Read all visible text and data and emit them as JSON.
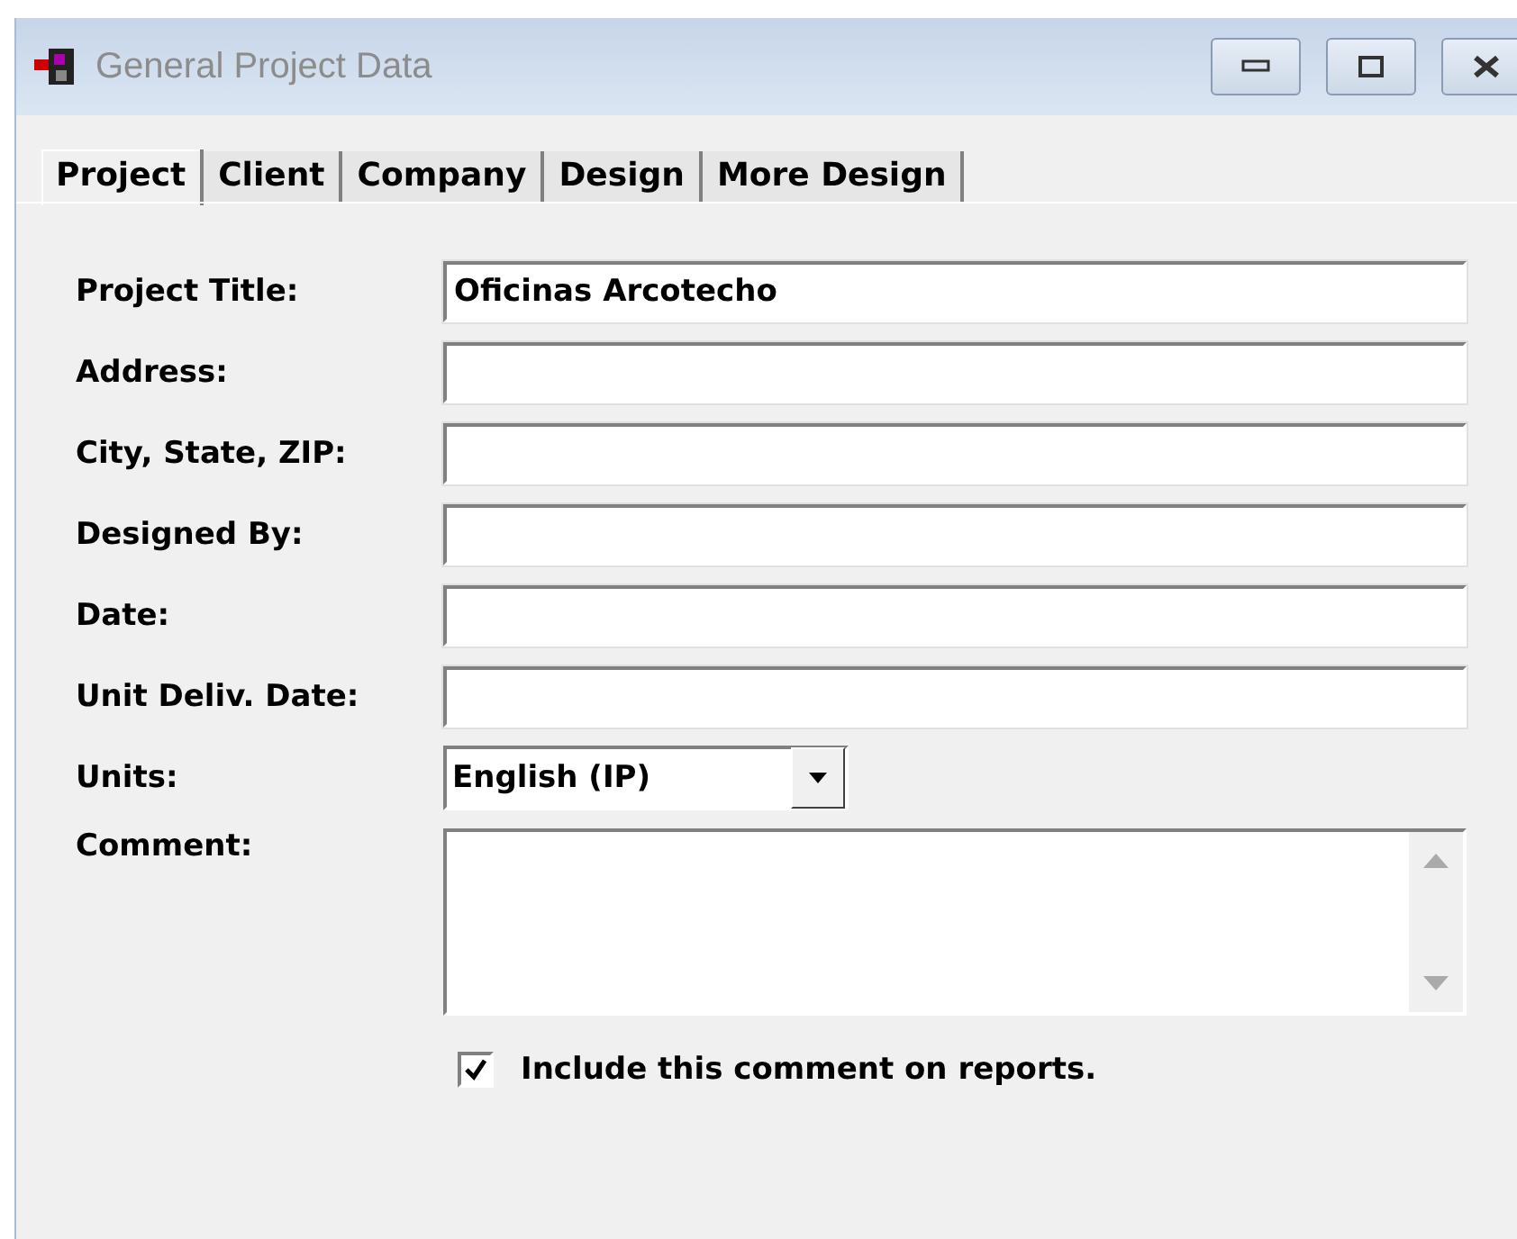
{
  "window": {
    "title": "General Project Data"
  },
  "tabs": [
    {
      "label": "Project",
      "selected": true
    },
    {
      "label": "Client",
      "selected": false
    },
    {
      "label": "Company",
      "selected": false
    },
    {
      "label": "Design",
      "selected": false
    },
    {
      "label": "More Design",
      "selected": false
    }
  ],
  "fields": [
    {
      "label": "Project Title:",
      "value": "Oficinas Arcotecho"
    },
    {
      "label": "Address:"
    },
    {
      "label": "City, State, ZIP:"
    },
    {
      "label": "Designed By:"
    },
    {
      "label": "Date:"
    },
    {
      "label": "Unit Deliv. Date:"
    }
  ],
  "units": {
    "label": "Units:",
    "value": "English (IP)"
  },
  "comment": {
    "label": "Comment:"
  },
  "include_comment": {
    "label": "Include this comment on reports.",
    "checked": true
  }
}
